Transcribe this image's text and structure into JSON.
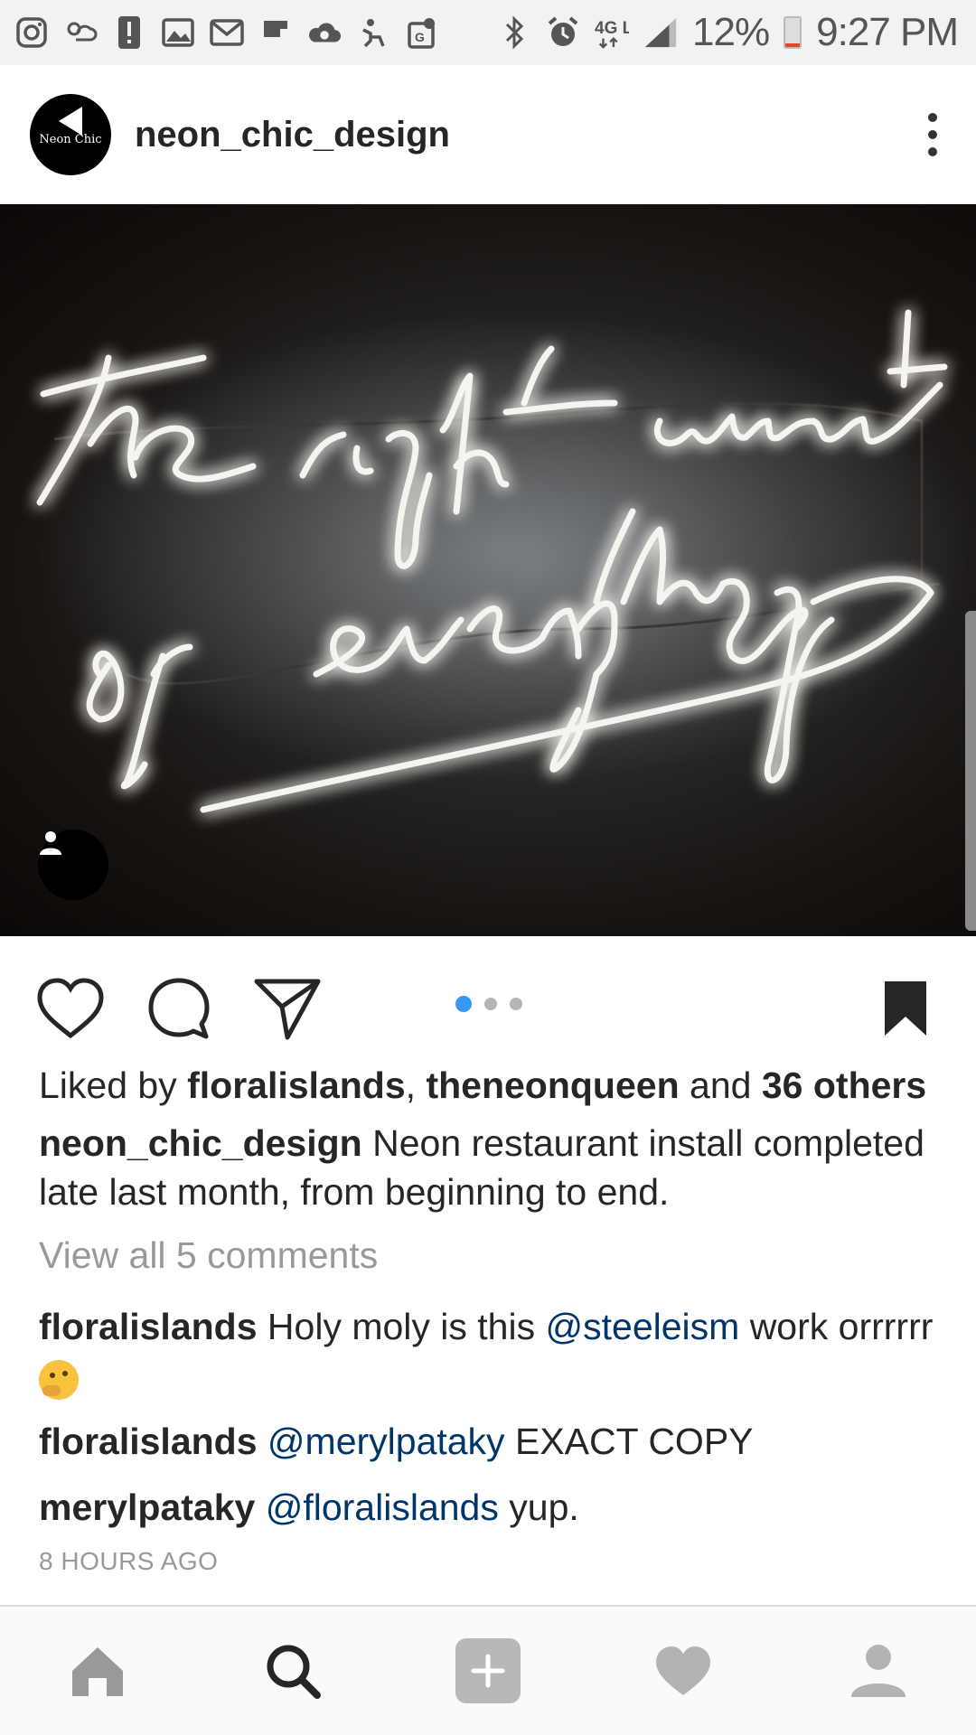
{
  "status_bar": {
    "battery": "12%",
    "time": "9:27 PM",
    "network": "4G LTE",
    "battery_level": 0.12,
    "icons": [
      "instagram-icon",
      "weather-icon",
      "alert-icon",
      "gallery-icon",
      "mail-icon",
      "flipboard-icon",
      "cloud-icon",
      "accessibility-icon",
      "maps-icon"
    ]
  },
  "post": {
    "username": "neon_chic_design",
    "avatar_text": "Neon Chic",
    "image_alt": "The right amount of everything",
    "carousel": {
      "total": 3,
      "active": 0
    },
    "likes": {
      "prefix": "Liked by",
      "user1": "floralislands",
      "separator": ",",
      "user2": "theneonqueen",
      "and": "and",
      "others": "36 others"
    },
    "caption": {
      "user": "neon_chic_design",
      "text": "Neon restaurant install completed late last month, from beginning to end."
    },
    "view_all": "View all 5 comments",
    "comments": [
      {
        "user": "floralislands",
        "before": "Holy moly is this",
        "mention": "@steeleism",
        "after": "work orrrrrr"
      },
      {
        "user": "floralislands",
        "before": "",
        "mention": "@merylpataky",
        "after": "EXACT COPY"
      },
      {
        "user": "merylpataky",
        "before": "",
        "mention": "@floralislands",
        "after": "yup."
      }
    ],
    "timestamp": "8 HOURS AGO"
  },
  "colors": {
    "accent": "#3897f0",
    "mention": "#003569",
    "text": "#262626",
    "muted": "#999999"
  },
  "bottom_nav": [
    "home-icon",
    "search-icon",
    "add-icon",
    "heart-icon",
    "profile-icon"
  ]
}
